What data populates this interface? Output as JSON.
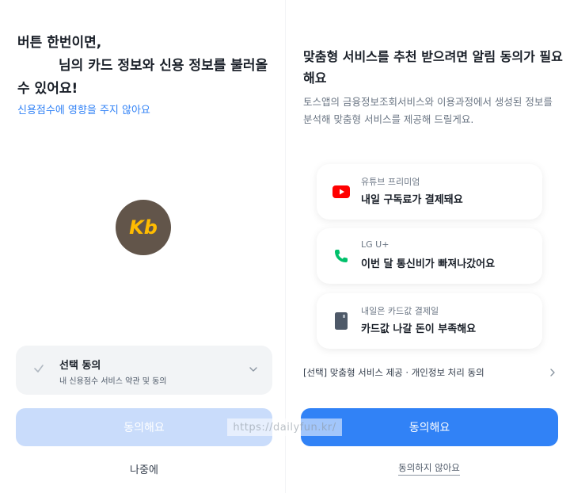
{
  "left": {
    "title_line1": "버튼 한번이면,",
    "title_line2": "님의 카드 정보와 신용 정보를 불러올",
    "title_line3": "수 있어요!",
    "subtitle": "신용점수에 영향을 주지 않아요",
    "logo_text": "Kb",
    "consent": {
      "title": "선택 동의",
      "desc": "내 신용점수 서비스 약관 및 동의"
    },
    "agree_button": "동의해요",
    "later_link": "나중에"
  },
  "right": {
    "title": "맞춤형 서비스를 추천 받으려면 알림 동의가 필요해요",
    "subtitle": "토스앱의 금융정보조회서비스와 이용과정에서 생성된 정보를 분석해 맞춤형 서비스를 제공해 드릴게요.",
    "cards": [
      {
        "icon": "youtube-icon",
        "caption": "유튜브 프리미엄",
        "main": "내일 구독료가 결제돼요"
      },
      {
        "icon": "phone-icon",
        "caption": "LG U+",
        "main": "이번 달 통신비가 빠져나갔어요"
      },
      {
        "icon": "card-icon",
        "caption": "내일은 카드값 결제일",
        "main": "카드값 나갈 돈이 부족해요"
      }
    ],
    "consent_text": "[선택] 맞춤형 서비스 제공 · 개인정보 처리 동의",
    "agree_button": "동의해요",
    "decline_link": "동의하지 않아요"
  },
  "watermark": "https://dailyfun.kr/",
  "colors": {
    "primary": "#3182f6",
    "primary_disabled": "#c9dcfb",
    "youtube_red": "#ff0000",
    "phone_green": "#00c06b",
    "kb_brown": "#62554a",
    "kb_yellow": "#ffbc00"
  }
}
